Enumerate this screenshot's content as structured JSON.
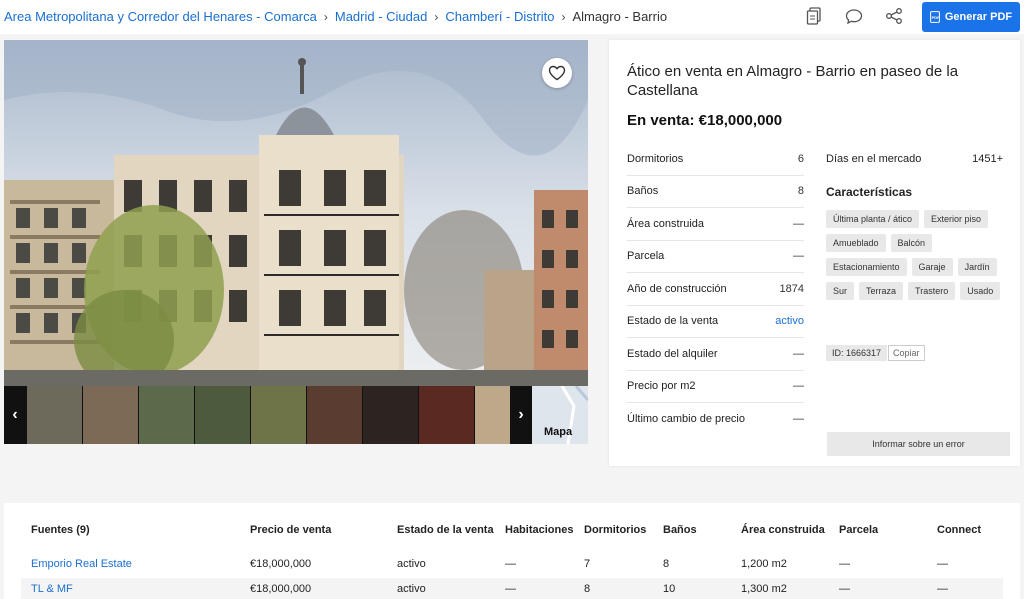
{
  "breadcrumb": {
    "items": [
      "Area Metropolitana y Corredor del Henares - Comarca",
      "Madrid - Ciudad",
      "Chamberí - Distrito"
    ],
    "current": "Almagro - Barrio"
  },
  "toolbar": {
    "icons": [
      "document-copy-icon",
      "comment-icon",
      "share-icon"
    ],
    "pdf_label": "Generar PDF"
  },
  "gallery": {
    "map_label": "Mapa",
    "prev_glyph": "‹",
    "next_glyph": "›"
  },
  "listing": {
    "title": "Ático en venta en Almagro - Barrio en paseo de la Castellana",
    "price": "En venta: €18,000,000",
    "facts": [
      {
        "label": "Dormitorios",
        "value": "6"
      },
      {
        "label": "Baños",
        "value": "8"
      },
      {
        "label": "Área construida",
        "value": "—"
      },
      {
        "label": "Parcela",
        "value": "—"
      },
      {
        "label": "Año de construcción",
        "value": "1874"
      },
      {
        "label": "Estado de la venta",
        "value": "activo"
      },
      {
        "label": "Estado del alquiler",
        "value": "—"
      },
      {
        "label": "Precio por m2",
        "value": "—"
      },
      {
        "label": "Último cambio de precio",
        "value": "—"
      }
    ],
    "days_label": "Días en el mercado",
    "days_value": "1451+",
    "features_title": "Características",
    "features": [
      "Última planta / ático",
      "Exterior piso",
      "Amueblado",
      "Balcón",
      "Estacionamiento",
      "Garaje",
      "Jardín",
      "Sur",
      "Terraza",
      "Trastero",
      "Usado"
    ],
    "id_label": "ID: 1666317",
    "copy_label": "Copiar",
    "report_label": "Informar sobre un error"
  },
  "sources": {
    "headers": [
      "Fuentes (9)",
      "Precio de venta",
      "Estado de la venta",
      "Habitaciones",
      "Dormitorios",
      "Baños",
      "Área construida",
      "Parcela",
      "Connect"
    ],
    "rows": [
      [
        "Emporio Real Estate",
        "€18,000,000",
        "activo",
        "—",
        "7",
        "8",
        "1,200 m2",
        "—",
        "—"
      ],
      [
        "TL & MF",
        "€18,000,000",
        "activo",
        "—",
        "8",
        "10",
        "1,300 m2",
        "—",
        "—"
      ]
    ]
  },
  "colors": {
    "link": "#1a6fd1",
    "primary_button": "#1a73e8"
  }
}
